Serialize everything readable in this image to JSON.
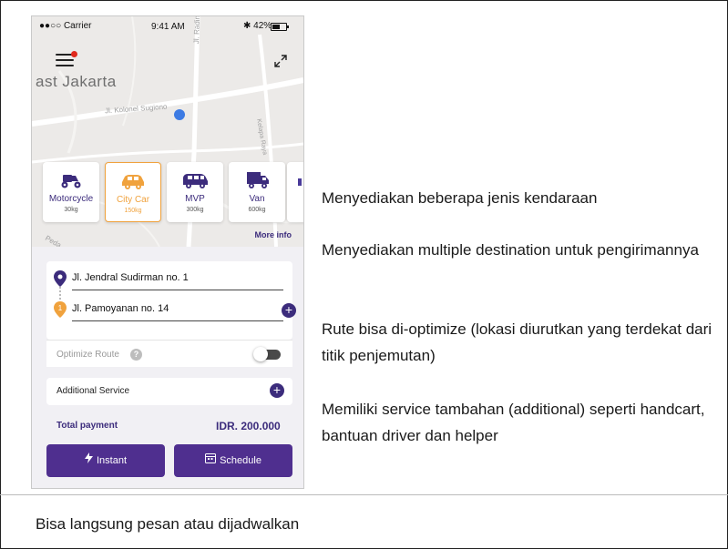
{
  "phone": {
    "status_bar": {
      "carrier": "●●○○ Carrier",
      "time": "9:41 AM",
      "battery": "✱ 42%"
    },
    "map": {
      "city_label": "ast Jakarta",
      "streets": [
        "Jl. Kolonel Sugiono",
        "Jl. Radin Inten II",
        "Kelapa Raya",
        "Peda"
      ]
    },
    "vehicles": [
      {
        "name": "Motorcycle",
        "capacity": "30kg",
        "icon": "motorcycle-icon",
        "selected": false
      },
      {
        "name": "City Car",
        "capacity": "150kg",
        "icon": "city-car-icon",
        "selected": true
      },
      {
        "name": "MVP",
        "capacity": "300kg",
        "icon": "mvp-icon",
        "selected": false
      },
      {
        "name": "Van",
        "capacity": "600kg",
        "icon": "van-icon",
        "selected": false
      }
    ],
    "more_info": "More info",
    "destinations": {
      "origin": "Jl. Jendral Sudirman no. 1",
      "stop_1": "Jl. Pamoyanan no. 14",
      "stop_1_number": "1"
    },
    "optimize_route": {
      "label": "Optimize Route",
      "help": "?",
      "enabled": false
    },
    "additional_service": "Additional Service",
    "total": {
      "label": "Total payment",
      "value": "IDR. 200.000"
    },
    "buttons": {
      "instant": "Instant",
      "schedule": "Schedule"
    }
  },
  "descriptions": [
    "Menyediakan beberapa jenis kendaraan",
    "Menyediakan multiple destination untuk pengirimannya",
    "Rute bisa di-optimize (lokasi diurutkan yang terdekat dari titik penjemutan)",
    "Memiliki service tambahan (additional) seperti handcart, bantuan driver dan helper"
  ],
  "footer_caption": "Bisa langsung pesan atau dijadwalkan",
  "colors": {
    "primary": "#4f2f8f",
    "accent": "#f0a23d",
    "location_dot": "#3d7be3",
    "notification": "#e0291c"
  }
}
